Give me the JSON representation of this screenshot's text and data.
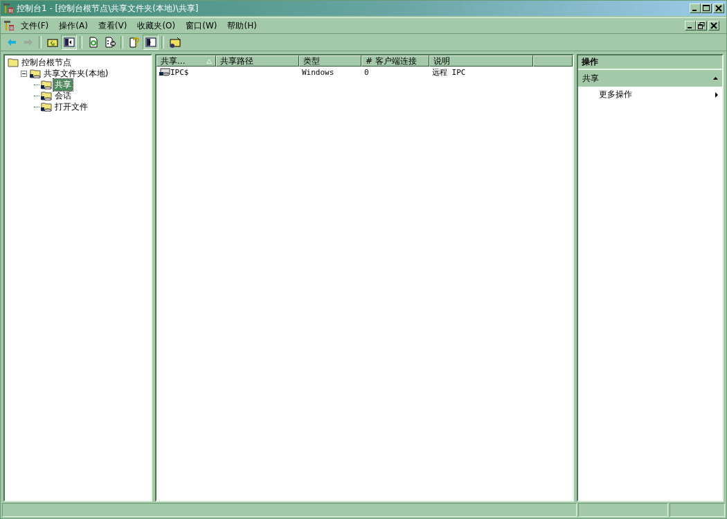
{
  "window": {
    "title": "控制台1 - [控制台根节点\\共享文件夹(本地)\\共享]"
  },
  "menu": [
    "文件(F)",
    "操作(A)",
    "查看(V)",
    "收藏夹(O)",
    "窗口(W)",
    "帮助(H)"
  ],
  "toolbar": [
    {
      "kind": "back",
      "disabled": false,
      "pressed": false
    },
    {
      "kind": "forward",
      "disabled": true,
      "pressed": false
    },
    {
      "kind": "sep"
    },
    {
      "kind": "up",
      "disabled": false,
      "pressed": false
    },
    {
      "kind": "tree",
      "disabled": false,
      "pressed": true
    },
    {
      "kind": "sep"
    },
    {
      "kind": "refresh",
      "disabled": false,
      "pressed": false
    },
    {
      "kind": "export",
      "disabled": false,
      "pressed": false
    },
    {
      "kind": "sep"
    },
    {
      "kind": "help",
      "disabled": false,
      "pressed": false
    },
    {
      "kind": "actionpane",
      "disabled": false,
      "pressed": true
    },
    {
      "kind": "sep"
    },
    {
      "kind": "newshare",
      "disabled": false,
      "pressed": false
    }
  ],
  "tree": [
    {
      "label": "控制台根节点",
      "kind": "folder",
      "selected": false,
      "children": [
        {
          "label": "共享文件夹(本地)",
          "kind": "share",
          "expanded": true,
          "selected": false,
          "children": [
            {
              "label": "共享",
              "kind": "share",
              "selected": true
            },
            {
              "label": "会话",
              "kind": "share",
              "selected": false
            },
            {
              "label": "打开文件",
              "kind": "share",
              "selected": false
            }
          ]
        }
      ]
    }
  ],
  "table": {
    "columns": [
      {
        "label": "共享...",
        "sorted": true
      },
      {
        "label": "共享路径",
        "sorted": false
      },
      {
        "label": "类型",
        "sorted": false
      },
      {
        "label": "# 客户端连接",
        "sorted": false
      },
      {
        "label": "说明",
        "sorted": false
      }
    ],
    "rows": [
      [
        "IPC$",
        "",
        "Windows",
        "0",
        "远程 IPC"
      ]
    ]
  },
  "actions": {
    "title": "操作",
    "sections": [
      {
        "label": "共享",
        "expanded": true,
        "items": [
          "更多操作"
        ]
      }
    ]
  }
}
